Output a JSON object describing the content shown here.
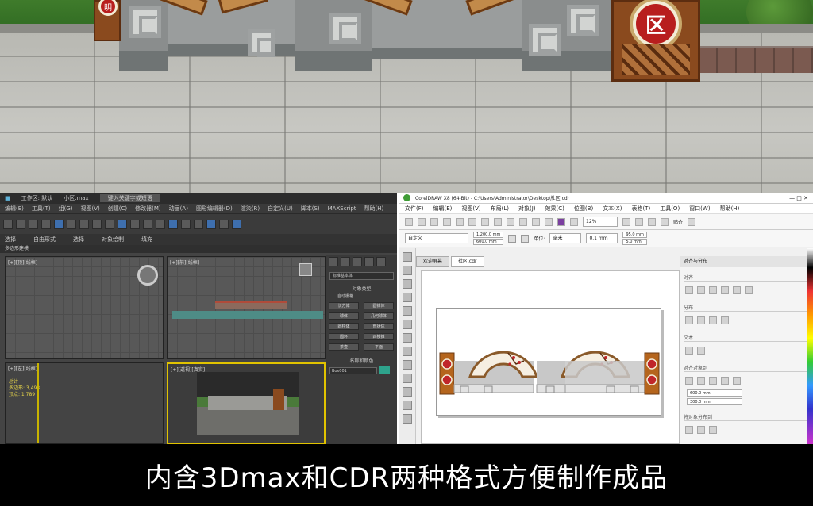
{
  "scene": {
    "sign_char_right": "区",
    "sign_char_left": "明"
  },
  "max": {
    "title_file": "小区.max",
    "title_search": "键入关键字或短语",
    "menus": [
      "编辑(E)",
      "工具(T)",
      "组(G)",
      "视图(V)",
      "创建(C)",
      "修改器(M)",
      "动画(A)",
      "图形编辑器(D)",
      "渲染(R)",
      "自定义(U)",
      "脚本(S)",
      "MAXScript",
      "帮助(H)"
    ],
    "workspace": "工作区: 默认",
    "ribbon": [
      "选择",
      "自由形式",
      "选择",
      "对象绘制",
      "填充"
    ],
    "ribbon_sub": "多边形建模",
    "vp_top": "[+][顶][线框]",
    "vp_front": "[+][前][线框]",
    "vp_left": "[+][左][线框]",
    "vp_persp": "[+][透视][真实]",
    "vp_left_stats": [
      "总计",
      "多边形: 3,498",
      "顶点: 1,789"
    ],
    "cmd_dropdown": "标准基本体",
    "cmd_rollout": "对象类型",
    "cmd_autogrid": "自动栅格",
    "cmd_buttons": [
      "长方体",
      "圆锥体",
      "球体",
      "几何球体",
      "圆柱体",
      "管状体",
      "圆环",
      "四棱锥",
      "茶壶",
      "平面"
    ],
    "cmd_name_section": "名称和颜色",
    "cmd_name_value": "Box001"
  },
  "cdr": {
    "title": "CorelDRAW X8 (64-Bit) - C:\\Users\\Administrator\\Desktop\\社区.cdr",
    "menus": [
      "文件(F)",
      "编辑(E)",
      "视图(V)",
      "布局(L)",
      "对象(J)",
      "效果(C)",
      "位图(B)",
      "文本(X)",
      "表格(T)",
      "工具(O)",
      "窗口(W)",
      "帮助(H)"
    ],
    "zoom": "12%",
    "snap": "贴齐",
    "preset": "自定义",
    "width_field": "1,200.0 mm",
    "height_field": "600.0 mm",
    "units_label": "单位:",
    "units_value": "毫米",
    "nudge": "0.1 mm",
    "dup_x": "95.0 mm",
    "dup_y": "5.0 mm",
    "tab_home": "欢迎屏幕",
    "tab_doc": "社区.cdr",
    "dock_title": "对齐与分布",
    "dock_align": "对齐",
    "dock_distribute": "分布",
    "dock_text": "文本",
    "dock_obj_pos": "对齐对象到",
    "dock_x": "600.0 mm",
    "dock_y": "300.0 mm",
    "dock_spacing": "将对象分布到"
  },
  "caption": "内含3Dmax和CDR两种格式方便制作成品"
}
